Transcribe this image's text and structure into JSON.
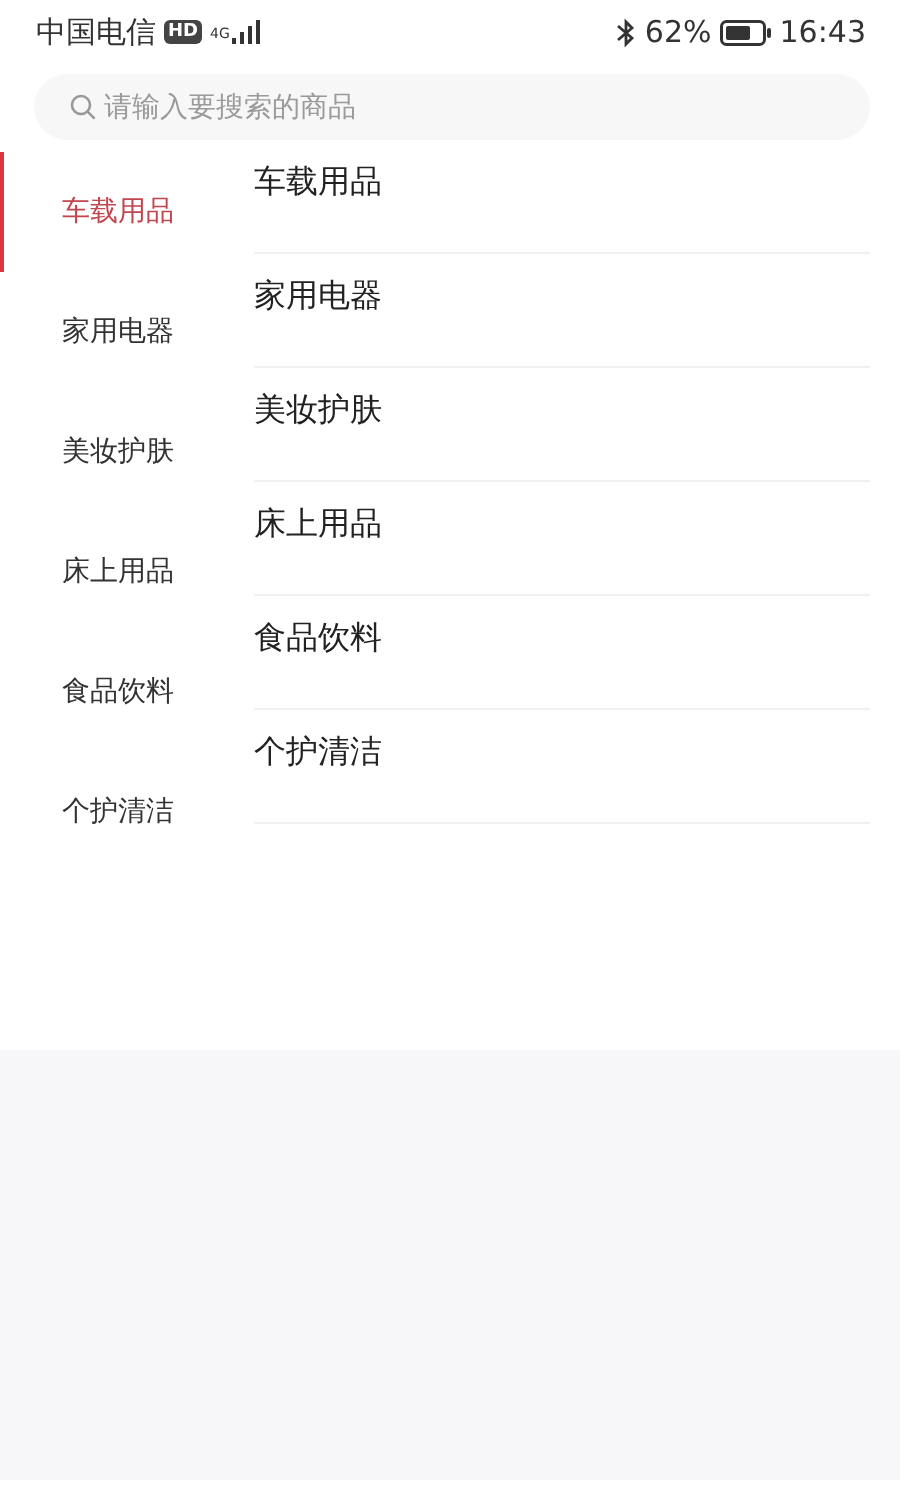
{
  "status_bar": {
    "carrier": "中国电信",
    "hd_badge": "HD",
    "network": "4G",
    "battery_percent": "62%",
    "time": "16:43"
  },
  "search": {
    "placeholder": "请输入要搜索的商品"
  },
  "sidebar": {
    "items": [
      {
        "label": "车载用品",
        "selected": true
      },
      {
        "label": "家用电器",
        "selected": false
      },
      {
        "label": "美妆护肤",
        "selected": false
      },
      {
        "label": "床上用品",
        "selected": false
      },
      {
        "label": "食品饮料",
        "selected": false
      },
      {
        "label": "个护清洁",
        "selected": false
      }
    ]
  },
  "categories": [
    {
      "label": "车载用品"
    },
    {
      "label": "家用电器"
    },
    {
      "label": "美妆护肤"
    },
    {
      "label": "床上用品"
    },
    {
      "label": "食品饮料"
    },
    {
      "label": "个护清洁"
    }
  ]
}
